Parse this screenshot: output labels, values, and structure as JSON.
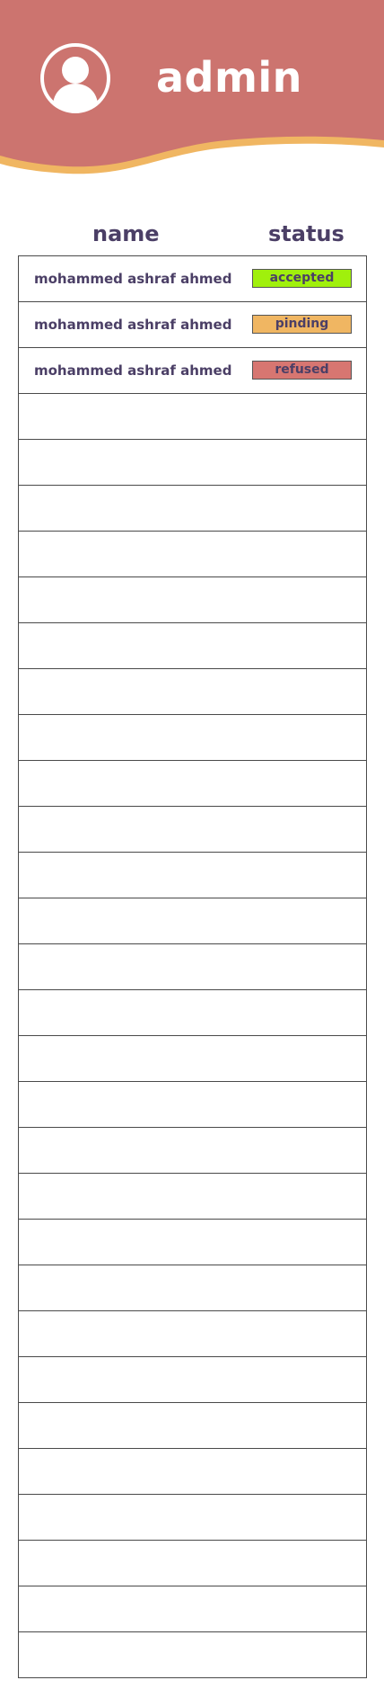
{
  "header": {
    "title": "admin",
    "avatar_icon": "user-icon",
    "background_color": "#cc746f",
    "wave_color": "#f0b662"
  },
  "table": {
    "columns": [
      "name",
      "status"
    ],
    "rows": [
      {
        "name": "mohammed ashraf ahmed",
        "status": "accepted",
        "status_color": "#a0f00c"
      },
      {
        "name": "mohammed ashraf ahmed",
        "status": "pinding",
        "status_color": "#f0b662"
      },
      {
        "name": "mohammed ashraf ahmed",
        "status": "refused",
        "status_color": "#d77671"
      }
    ],
    "empty_row_count": 28
  }
}
